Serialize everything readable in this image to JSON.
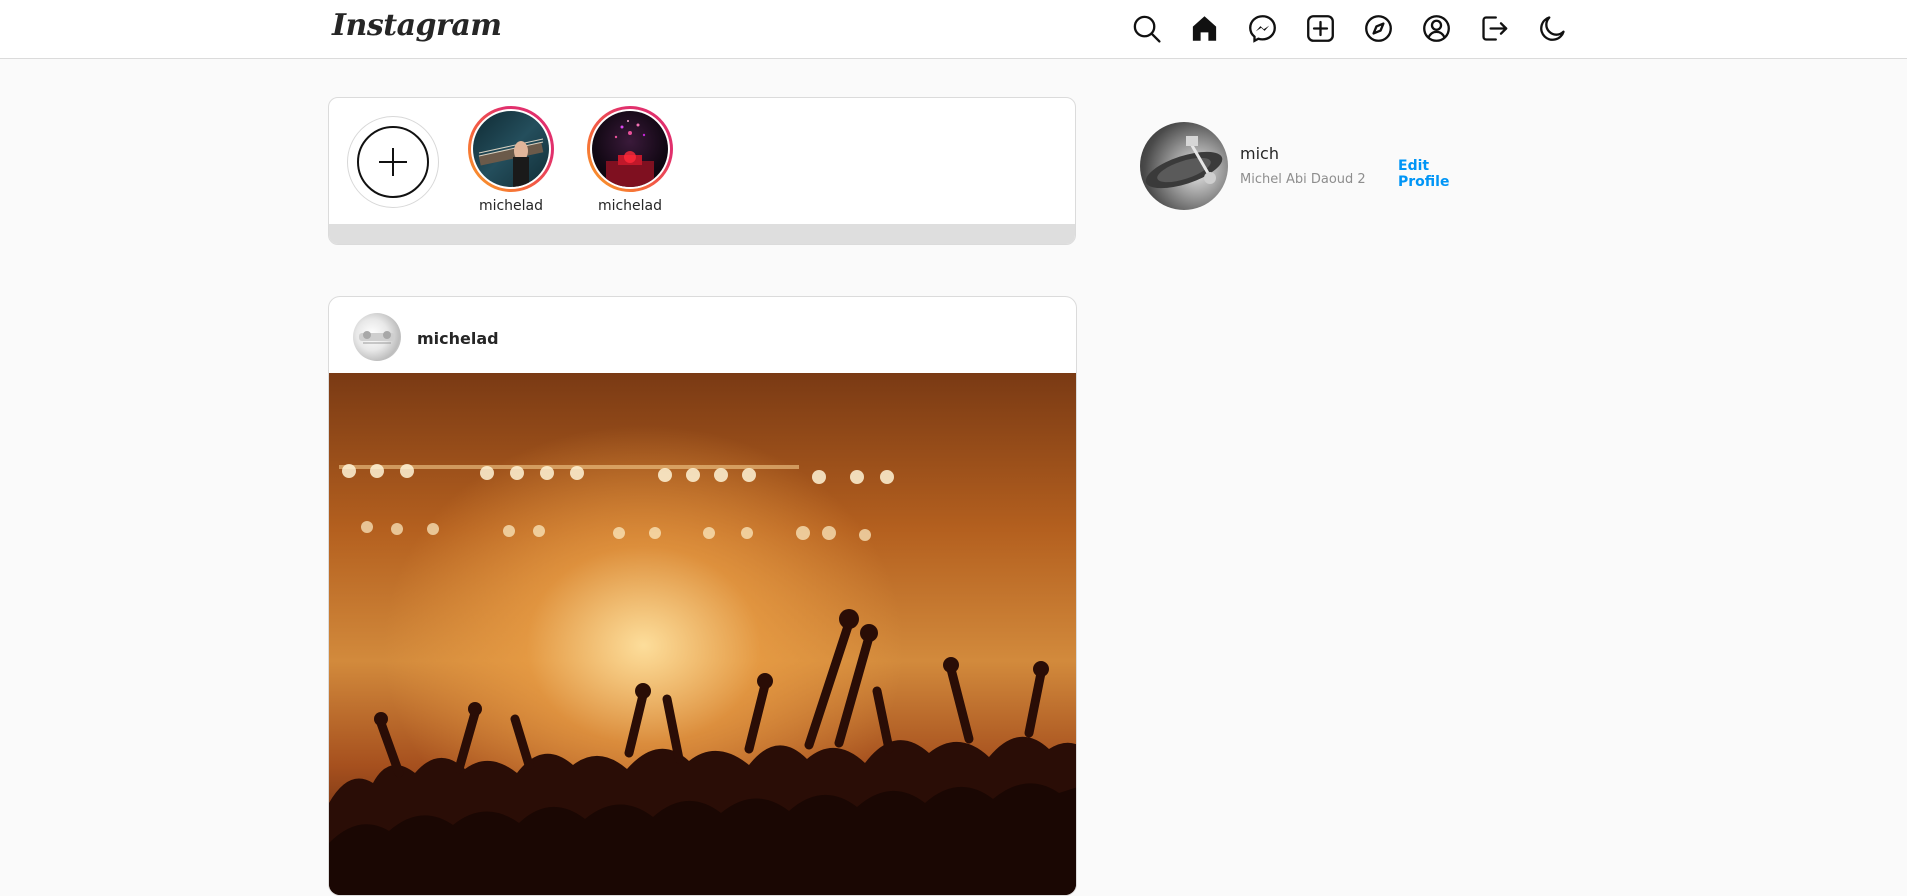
{
  "header": {
    "logo_text": "Instagram",
    "nav_icons": [
      "search-icon",
      "home-icon",
      "messenger-icon",
      "new-post-icon",
      "explore-icon",
      "profile-icon",
      "logout-icon",
      "dark-mode-icon"
    ]
  },
  "stories": {
    "add_icon": "plus-icon",
    "items": [
      {
        "username": "michelad"
      },
      {
        "username": "michelad"
      }
    ]
  },
  "post": {
    "username": "michelad"
  },
  "profile": {
    "username": "mich",
    "full_name": "Michel Abi Daoud 2",
    "edit_label": "Edit Profile"
  },
  "colors": {
    "accent": "#0095f6",
    "background": "#fafafa",
    "border": "#dbdbdb"
  }
}
